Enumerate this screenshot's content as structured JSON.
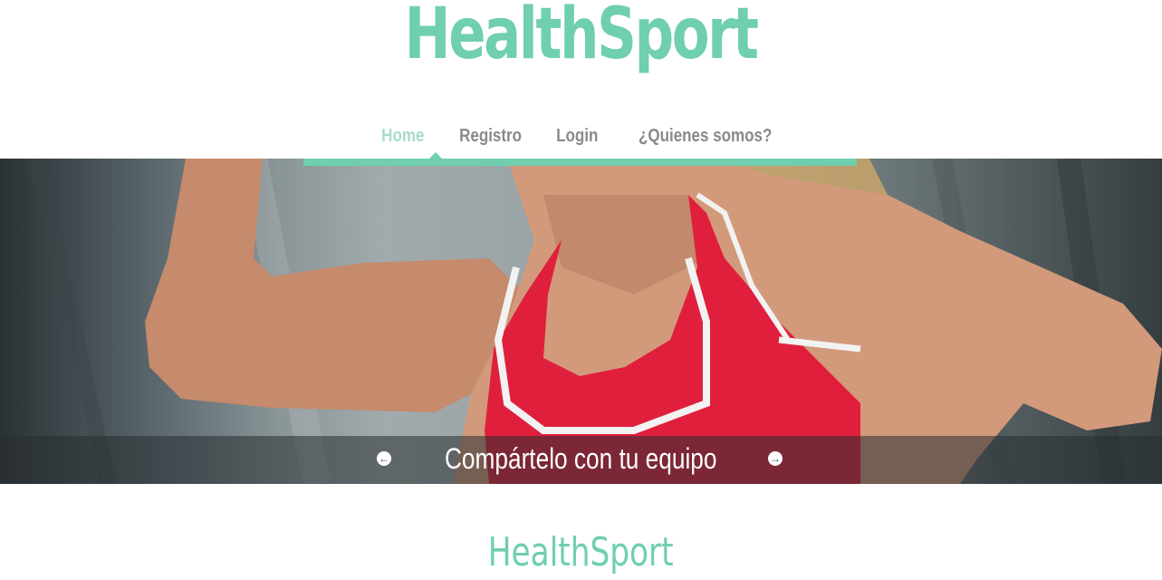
{
  "brand": {
    "logo_text": "HealthSport",
    "accent_color": "#6fcfae"
  },
  "nav": {
    "items": [
      {
        "label": "Home",
        "active": true
      },
      {
        "label": "Registro",
        "active": false
      },
      {
        "label": "Login",
        "active": false
      },
      {
        "label": "¿Quienes somos?",
        "active": false
      }
    ]
  },
  "hero": {
    "caption": "Compártelo con tu equipo",
    "prev_icon": "arrow-left-circle-icon",
    "next_icon": "arrow-right-circle-icon"
  },
  "section": {
    "title": "HealthSport"
  }
}
